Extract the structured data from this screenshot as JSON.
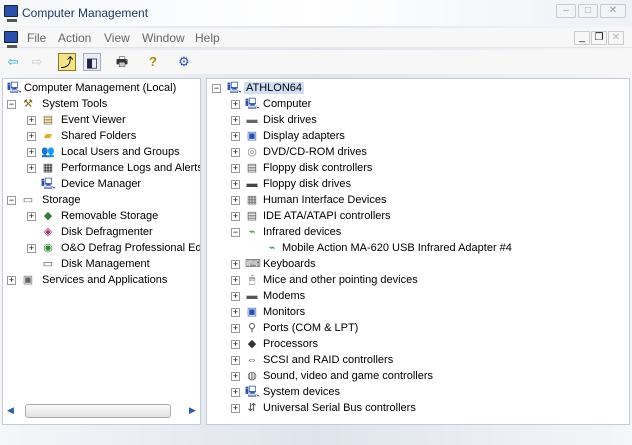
{
  "window": {
    "title": "Computer Management",
    "min": "–",
    "max": "□",
    "close": "✕"
  },
  "menu": {
    "items": [
      "File",
      "Action",
      "View",
      "Window",
      "Help"
    ],
    "mdi_min": "_",
    "mdi_restore": "❐",
    "mdi_close": "✕"
  },
  "toolbar": {
    "icons": [
      "back-icon",
      "forward-icon",
      "up-folder-icon",
      "show-hide-tree-icon",
      "print-icon",
      "help-icon",
      "properties-icon"
    ],
    "glyphs": [
      "⇦",
      "⇨",
      "⤴",
      "◧",
      "🖶",
      "?",
      "⚙"
    ]
  },
  "left_tree": [
    {
      "label": "Computer Management (Local)",
      "level": 0,
      "exp": "",
      "icon": "computer-icon",
      "g": "🖳",
      "color": "#2b4fa8"
    },
    {
      "label": "System Tools",
      "level": 1,
      "exp": "−",
      "icon": "tools-icon",
      "g": "⚒",
      "color": "#8a6a20"
    },
    {
      "label": "Event Viewer",
      "level": 2,
      "exp": "+",
      "icon": "event-viewer-icon",
      "g": "▤",
      "color": "#8a6a20"
    },
    {
      "label": "Shared Folders",
      "level": 2,
      "exp": "+",
      "icon": "shared-folders-icon",
      "g": "▰",
      "color": "#d8b030"
    },
    {
      "label": "Local Users and Groups",
      "level": 2,
      "exp": "+",
      "icon": "users-icon",
      "g": "👥",
      "color": "#555"
    },
    {
      "label": "Performance Logs and Alerts",
      "level": 2,
      "exp": "+",
      "icon": "performance-icon",
      "g": "▦",
      "color": "#333"
    },
    {
      "label": "Device Manager",
      "level": 2,
      "exp": "",
      "icon": "device-manager-icon",
      "g": "🖳",
      "color": "#2b4fa8"
    },
    {
      "label": "Storage",
      "level": 1,
      "exp": "−",
      "icon": "storage-icon",
      "g": "▭",
      "color": "#666"
    },
    {
      "label": "Removable Storage",
      "level": 2,
      "exp": "+",
      "icon": "removable-storage-icon",
      "g": "◆",
      "color": "#3a7a3a"
    },
    {
      "label": "Disk Defragmenter",
      "level": 2,
      "exp": "",
      "icon": "defrag-icon",
      "g": "◈",
      "color": "#a03070"
    },
    {
      "label": "O&O Defrag Professional Edi",
      "level": 2,
      "exp": "+",
      "icon": "oo-defrag-icon",
      "g": "◉",
      "color": "#3a8a3a"
    },
    {
      "label": "Disk Management",
      "level": 2,
      "exp": "",
      "icon": "disk-management-icon",
      "g": "▭",
      "color": "#555"
    },
    {
      "label": "Services and Applications",
      "level": 1,
      "exp": "+",
      "icon": "services-icon",
      "g": "▣",
      "color": "#666"
    }
  ],
  "right_tree": [
    {
      "label": "ATHLON64",
      "level": 0,
      "exp": "−",
      "icon": "computer-icon",
      "g": "🖳",
      "color": "#2b4fa8",
      "selected": true
    },
    {
      "label": "Computer",
      "level": 1,
      "exp": "+",
      "icon": "computer-icon",
      "g": "🖳",
      "color": "#2b4fa8"
    },
    {
      "label": "Disk drives",
      "level": 1,
      "exp": "+",
      "icon": "disk-drive-icon",
      "g": "▬",
      "color": "#666"
    },
    {
      "label": "Display adapters",
      "level": 1,
      "exp": "+",
      "icon": "display-icon",
      "g": "▣",
      "color": "#2b4fa8"
    },
    {
      "label": "DVD/CD-ROM drives",
      "level": 1,
      "exp": "+",
      "icon": "cdrom-icon",
      "g": "◎",
      "color": "#777"
    },
    {
      "label": "Floppy disk controllers",
      "level": 1,
      "exp": "+",
      "icon": "controller-icon",
      "g": "▤",
      "color": "#555"
    },
    {
      "label": "Floppy disk drives",
      "level": 1,
      "exp": "+",
      "icon": "floppy-icon",
      "g": "▬",
      "color": "#444"
    },
    {
      "label": "Human Interface Devices",
      "level": 1,
      "exp": "+",
      "icon": "hid-icon",
      "g": "▦",
      "color": "#666"
    },
    {
      "label": "IDE ATA/ATAPI controllers",
      "level": 1,
      "exp": "+",
      "icon": "ide-icon",
      "g": "▤",
      "color": "#555"
    },
    {
      "label": "Infrared devices",
      "level": 1,
      "exp": "−",
      "icon": "infrared-icon",
      "g": "⌁",
      "color": "#3a8a3a"
    },
    {
      "label": "Mobile Action MA-620 USB Infrared Adapter #4",
      "level": 2,
      "exp": "",
      "icon": "infrared-adapter-icon",
      "g": "⌁",
      "color": "#3a8a3a"
    },
    {
      "label": "Keyboards",
      "level": 1,
      "exp": "+",
      "icon": "keyboard-icon",
      "g": "⌨",
      "color": "#666"
    },
    {
      "label": "Mice and other pointing devices",
      "level": 1,
      "exp": "+",
      "icon": "mouse-icon",
      "g": "🖱",
      "color": "#666"
    },
    {
      "label": "Modems",
      "level": 1,
      "exp": "+",
      "icon": "modem-icon",
      "g": "▬",
      "color": "#555"
    },
    {
      "label": "Monitors",
      "level": 1,
      "exp": "+",
      "icon": "monitor-icon",
      "g": "▣",
      "color": "#2b4fa8"
    },
    {
      "label": "Ports (COM & LPT)",
      "level": 1,
      "exp": "+",
      "icon": "port-icon",
      "g": "⚲",
      "color": "#555"
    },
    {
      "label": "Processors",
      "level": 1,
      "exp": "+",
      "icon": "processor-icon",
      "g": "◆",
      "color": "#333"
    },
    {
      "label": "SCSI and RAID controllers",
      "level": 1,
      "exp": "+",
      "icon": "scsi-icon",
      "g": "⇔",
      "color": "#444"
    },
    {
      "label": "Sound, video and game controllers",
      "level": 1,
      "exp": "+",
      "icon": "sound-icon",
      "g": "◍",
      "color": "#555"
    },
    {
      "label": "System devices",
      "level": 1,
      "exp": "+",
      "icon": "system-devices-icon",
      "g": "🖳",
      "color": "#2b4fa8"
    },
    {
      "label": "Universal Serial Bus controllers",
      "level": 1,
      "exp": "+",
      "icon": "usb-icon",
      "g": "⇵",
      "color": "#444"
    }
  ]
}
